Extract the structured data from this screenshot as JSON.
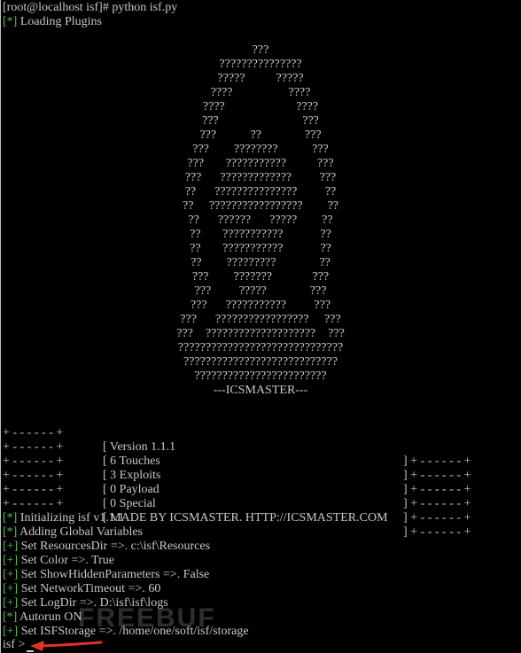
{
  "command_line": "[root@localhost isf]# python isf.py",
  "loading": {
    "tag": "[*]",
    "text": " Loading Plugins"
  },
  "ascii_art": [
    "???",
    "???????????????",
    "?????          ?????",
    "????                  ????",
    "????                       ????",
    "???                           ???",
    "???           ??              ???",
    "???        ????????           ???",
    "???       ???????????          ???",
    "???      ?????????????         ???",
    "??      ???????????????         ??",
    "??     ?????????????????        ??",
    "??      ??????      ?????        ??",
    "??       ???????????            ??",
    "??       ???????????            ??",
    "??        ?????????              ??",
    "???        ???????             ???",
    "???         ?????              ???",
    "???      ???????????         ???",
    "???      ?????????????????     ???",
    "???    ????????????????????    ???",
    "??????????????????????????????",
    "????????????????????????????",
    "????????????????????????",
    "---ICSMASTER---"
  ],
  "banner": {
    "left": "+ - - - - - - +",
    "right": "+ - - - - - - +",
    "rows": [
      {
        "text": "[ Version 1.1.1",
        "close": "]"
      },
      {
        "text": "[ 6 Touches",
        "close": "]"
      },
      {
        "text": "[ 3 Exploits",
        "close": "]"
      },
      {
        "text": "[ 0 Payload",
        "close": "]"
      },
      {
        "text": "[ 0 Special",
        "close": "]"
      },
      {
        "text": "[ MADE BY ICSMASTER. HTTP://ICSMASTER.COM",
        "close": "]"
      }
    ]
  },
  "log": [
    {
      "tag": "[*]",
      "text": " Initializing isf v1.1.1"
    },
    {
      "tag": "[*]",
      "text": " Adding Global Variables"
    },
    {
      "tag": "[+]",
      "text": " Set ResourcesDir =>. c:\\isf\\Resources"
    },
    {
      "tag": "[+]",
      "text": " Set Color =>. True"
    },
    {
      "tag": "[+]",
      "text": " Set ShowHiddenParameters =>. False"
    },
    {
      "tag": "[+]",
      "text": " Set NetworkTimeout =>. 60"
    },
    {
      "tag": "[+]",
      "text": " Set LogDir =>. D:\\isf\\isf\\logs"
    },
    {
      "tag": "[*]",
      "text": " Autorun ON"
    },
    {
      "tag": "[+]",
      "text": " Set ISFStorage =>. /home/one/soft/isf/storage"
    }
  ],
  "prompt": "isf >",
  "watermark_text": "FREEBUF",
  "colors": {
    "background": "#000000",
    "text": "#c8c8c8",
    "tag": "#4fc24f",
    "arrow": "#e0312a"
  }
}
